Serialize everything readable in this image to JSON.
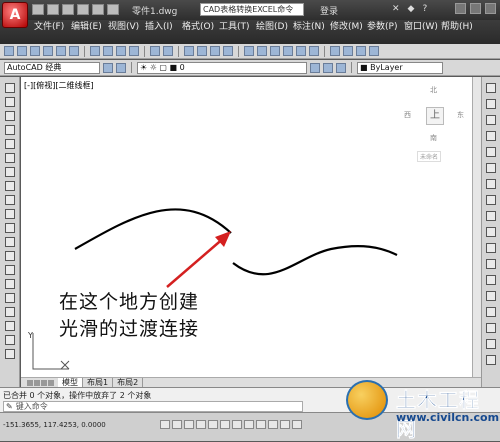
{
  "window": {
    "app_button": "A",
    "doc_title": "零件1.dwg",
    "search_text": "CAD表格转换EXCEL命令",
    "login": "登录"
  },
  "menu": [
    "文件(F)",
    "编辑(E)",
    "视图(V)",
    "插入(I)",
    "格式(O)",
    "工具(T)",
    "绘图(D)",
    "标注(N)",
    "修改(M)",
    "参数(P)",
    "窗口(W)",
    "帮助(H)"
  ],
  "toolbar": {
    "workspace": "AutoCAD 经典",
    "layer": "0",
    "color": "ByLayer"
  },
  "canvas": {
    "view_label": "[-][俯视][二维线框]",
    "annotation_line1": "在这个地方创建",
    "annotation_line2": "光滑的过渡连接",
    "ucs_y": "Y",
    "curve_color": "#000000",
    "arrow_color": "#d42020"
  },
  "viewcube": {
    "north": "北",
    "south": "南",
    "west": "西",
    "east": "东",
    "top": "上",
    "ucs": "未命名"
  },
  "tabs": [
    "模型",
    "布局1",
    "布局2"
  ],
  "command": {
    "history": "已合并 0 个对象，操作中放弃了 2 个对象",
    "prompt": "键入命令"
  },
  "status": {
    "coords": "-151.3655, 117.4253, 0.0000"
  },
  "watermark": {
    "name": "土木工程网",
    "url": "www.civilcn.com"
  }
}
